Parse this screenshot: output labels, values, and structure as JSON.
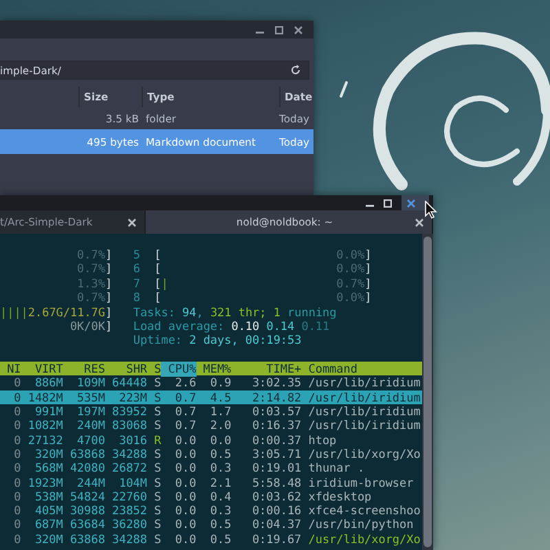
{
  "file_manager": {
    "path": "imple-Dark/",
    "columns": [
      "Size",
      "Type",
      "Date"
    ],
    "rows": [
      {
        "size": "3.5 kB",
        "type": "folder",
        "date": "Today",
        "selected": false
      },
      {
        "size": "495 bytes",
        "type": "Markdown document",
        "date": "Today",
        "selected": true
      }
    ]
  },
  "terminal": {
    "tabs": [
      {
        "title": "t/Arc-Simple-Dark",
        "selected": false
      },
      {
        "title": "nold@noldbook: ~",
        "selected": true
      }
    ],
    "cpu_rows": [
      {
        "left": "0.7%]",
        "cpu": "5",
        "bar": "[",
        "value": "0.0%]"
      },
      {
        "left": "0.7%]",
        "cpu": "6",
        "bar": "[",
        "value": "0.0%]"
      },
      {
        "left": "1.3%]",
        "cpu": "7",
        "bar": "[|",
        "value": "0.7%]"
      },
      {
        "left": "0.7%]",
        "cpu": "8",
        "bar": "[",
        "value": "0.0%]"
      }
    ],
    "memory": {
      "bar": "||||",
      "reading": "2.67G/11.7G]"
    },
    "swap": {
      "reading": "0K/0K]"
    },
    "info_lines": [
      [
        {
          "text": "Tasks: ",
          "kind": "label"
        },
        {
          "text": "94",
          "kind": "value"
        },
        {
          "text": ", ",
          "kind": "label"
        },
        {
          "text": "321",
          "kind": "green"
        },
        {
          "text": " thr; ",
          "kind": "green"
        },
        {
          "text": "1",
          "kind": "green"
        },
        {
          "text": " running",
          "kind": "label"
        }
      ],
      [
        {
          "text": "Load average: ",
          "kind": "label"
        },
        {
          "text": "0.10 ",
          "kind": "white"
        },
        {
          "text": "0.14 ",
          "kind": "value"
        },
        {
          "text": "0.11",
          "kind": "dim"
        }
      ],
      [
        {
          "text": "Uptime: ",
          "kind": "label"
        },
        {
          "text": "2 days, 00:19:53",
          "kind": "value"
        }
      ]
    ],
    "process_columns": [
      {
        "label": "NI",
        "selected": false
      },
      {
        "label": "VIRT",
        "selected": false
      },
      {
        "label": "RES",
        "selected": false
      },
      {
        "label": "SHR",
        "selected": false
      },
      {
        "label": "S",
        "selected": false
      },
      {
        "label": "CPU%",
        "selected": true
      },
      {
        "label": "MEM%",
        "selected": false
      },
      {
        "label": "TIME+",
        "selected": false
      },
      {
        "label": "Command",
        "selected": false
      }
    ],
    "processes": [
      {
        "ni": "0",
        "virt": "886M",
        "res": "109M",
        "shr": "64448",
        "s": "S",
        "cpu": "2.6",
        "mem": "0.9",
        "time": "3:02.35",
        "command": "/usr/lib/iridium",
        "selected": false,
        "running": false,
        "thread": false
      },
      {
        "ni": "0",
        "virt": "1482M",
        "res": "535M",
        "shr": "223M",
        "s": "S",
        "cpu": "0.7",
        "mem": "4.5",
        "time": "2:14.82",
        "command": "/usr/lib/iridium",
        "selected": true,
        "running": false,
        "thread": false
      },
      {
        "ni": "0",
        "virt": "991M",
        "res": "197M",
        "shr": "83952",
        "s": "S",
        "cpu": "0.7",
        "mem": "1.7",
        "time": "0:03.57",
        "command": "/usr/lib/iridium",
        "selected": false,
        "running": false,
        "thread": false
      },
      {
        "ni": "0",
        "virt": "1082M",
        "res": "240M",
        "shr": "83068",
        "s": "S",
        "cpu": "0.7",
        "mem": "2.0",
        "time": "0:16.37",
        "command": "/usr/lib/iridium",
        "selected": false,
        "running": false,
        "thread": false
      },
      {
        "ni": "0",
        "virt": "27132",
        "res": "4700",
        "shr": "3016",
        "s": "R",
        "cpu": "0.0",
        "mem": "0.0",
        "time": "0:00.37",
        "command": "htop",
        "selected": false,
        "running": true,
        "thread": false
      },
      {
        "ni": "0",
        "virt": "320M",
        "res": "63868",
        "shr": "34288",
        "s": "S",
        "cpu": "0.0",
        "mem": "0.5",
        "time": "3:05.71",
        "command": "/usr/lib/xorg/Xo",
        "selected": false,
        "running": false,
        "thread": false
      },
      {
        "ni": "0",
        "virt": "568M",
        "res": "42080",
        "shr": "26872",
        "s": "S",
        "cpu": "0.0",
        "mem": "0.3",
        "time": "0:19.01",
        "command": "thunar .",
        "selected": false,
        "running": false,
        "thread": false
      },
      {
        "ni": "0",
        "virt": "1923M",
        "res": "244M",
        "shr": "104M",
        "s": "S",
        "cpu": "0.0",
        "mem": "2.1",
        "time": "5:58.48",
        "command": "iridium-browser",
        "selected": false,
        "running": false,
        "thread": false
      },
      {
        "ni": "0",
        "virt": "538M",
        "res": "54824",
        "shr": "22760",
        "s": "S",
        "cpu": "0.0",
        "mem": "0.4",
        "time": "0:03.62",
        "command": "xfdesktop",
        "selected": false,
        "running": false,
        "thread": false
      },
      {
        "ni": "0",
        "virt": "405M",
        "res": "30988",
        "shr": "23852",
        "s": "S",
        "cpu": "0.0",
        "mem": "0.3",
        "time": "0:00.16",
        "command": "xfce4-screenshoo",
        "selected": false,
        "running": false,
        "thread": false
      },
      {
        "ni": "0",
        "virt": "687M",
        "res": "63684",
        "shr": "36280",
        "s": "S",
        "cpu": "0.0",
        "mem": "0.5",
        "time": "0:04.37",
        "command": "/usr/bin/python",
        "selected": false,
        "running": false,
        "thread": false
      },
      {
        "ni": "0",
        "virt": "320M",
        "res": "63868",
        "shr": "34288",
        "s": "S",
        "cpu": "0.0",
        "mem": "0.5",
        "time": "0:19.67",
        "command": "/usr/lib/xorg/Xo",
        "selected": false,
        "running": false,
        "thread": true
      }
    ]
  }
}
